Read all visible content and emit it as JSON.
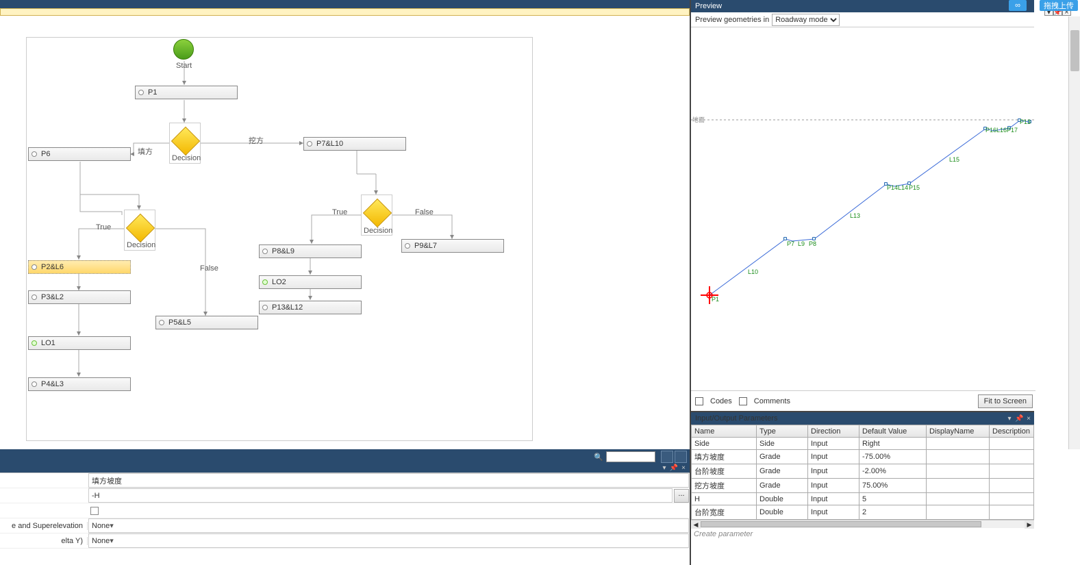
{
  "flowchart": {
    "start_label": "Start",
    "nodes": {
      "p1": "P1",
      "p6": "P6",
      "p7l10": "P7&L10",
      "p2l6": "P2&L6",
      "p3l2": "P3&L2",
      "p5l5": "P5&L5",
      "p8l9": "P8&L9",
      "p9l7": "P9&L7",
      "lo1": "LO1",
      "lo2": "LO2",
      "p4l3": "P4&L3",
      "p13l12": "P13&L12"
    },
    "decision_label": "Decision",
    "edge_labels": {
      "fill": "填方",
      "cut": "挖方",
      "true": "True",
      "false": "False"
    }
  },
  "preview": {
    "title": "Preview",
    "subtitle": "Preview geometries in",
    "mode_selected": "Roadway mode",
    "ground_label": "地面",
    "points": {
      "p1": "P1",
      "p7": "P7",
      "l9": "L9",
      "p8": "P8",
      "l10": "L10",
      "l13": "L13",
      "p14": "P14",
      "l14": "L14",
      "p15": "P15",
      "l15": "L15",
      "p16": "P16",
      "l16": "L16",
      "p17": "P17",
      "p13": "P13"
    },
    "codes_label": "Codes",
    "comments_label": "Comments",
    "fit_button": "Fit to Screen"
  },
  "io": {
    "title": "Input/Output Parameters",
    "columns": [
      "Name",
      "Type",
      "Direction",
      "Default Value",
      "DisplayName",
      "Description"
    ],
    "rows": [
      {
        "name": "Side",
        "type": "Side",
        "direction": "Input",
        "default": "Right",
        "display": "",
        "desc": ""
      },
      {
        "name": "填方坡度",
        "type": "Grade",
        "direction": "Input",
        "default": "-75.00%",
        "display": "",
        "desc": ""
      },
      {
        "name": "台阶坡度",
        "type": "Grade",
        "direction": "Input",
        "default": "-2.00%",
        "display": "",
        "desc": ""
      },
      {
        "name": "挖方坡度",
        "type": "Grade",
        "direction": "Input",
        "default": "75.00%",
        "display": "",
        "desc": ""
      },
      {
        "name": "H",
        "type": "Double",
        "direction": "Input",
        "default": "5",
        "display": "",
        "desc": ""
      },
      {
        "name": "台阶宽度",
        "type": "Double",
        "direction": "Input",
        "default": "2",
        "display": "",
        "desc": ""
      }
    ],
    "create_label": "Create parameter"
  },
  "properties": {
    "field1_label": "填方坡度",
    "field2_value": "-H",
    "field3_label": "e and Superelevation",
    "field3_value": "None",
    "field4_label": "elta Y)",
    "field4_value": "None",
    "ellipsis": "..."
  },
  "upload": {
    "label": "拖拽上传",
    "icon": "∞"
  }
}
